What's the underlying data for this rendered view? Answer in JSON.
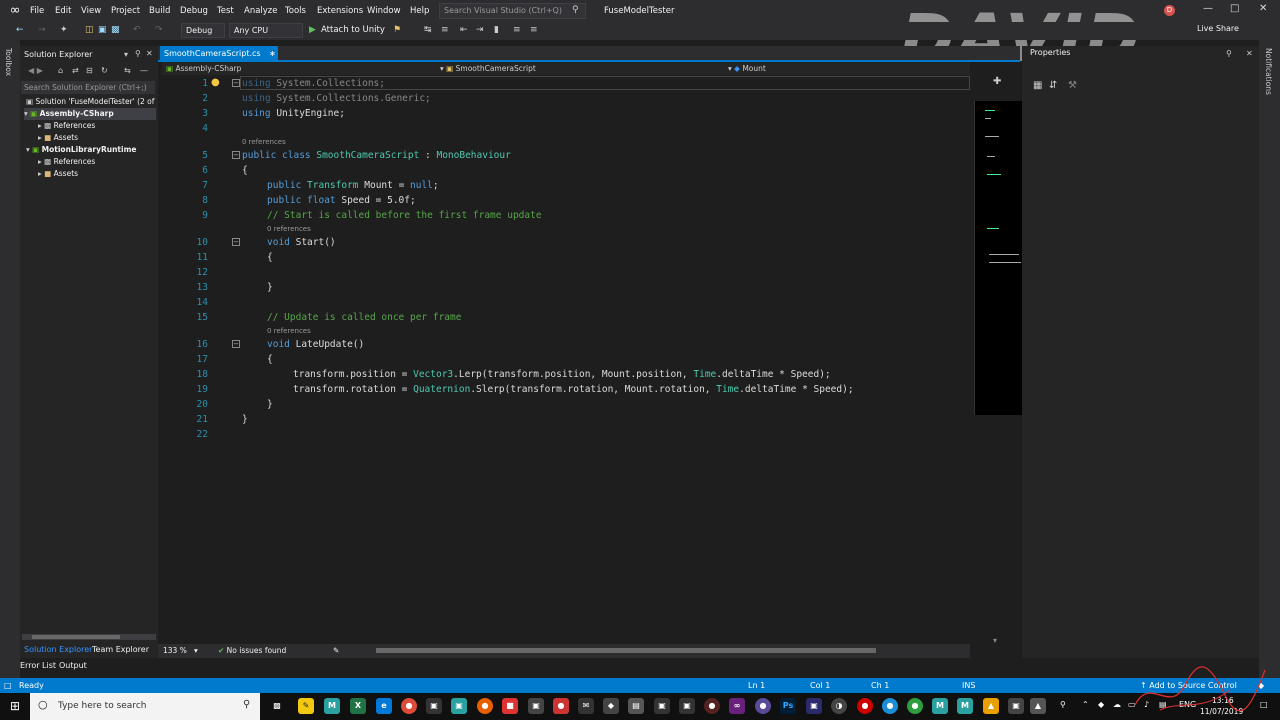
{
  "menu": [
    "File",
    "Edit",
    "View",
    "Project",
    "Build",
    "Debug",
    "Test",
    "Analyze",
    "Tools",
    "Extensions",
    "Window",
    "Help"
  ],
  "search_placeholder": "Search Visual Studio (Ctrl+Q)",
  "solution_name": "FuseModelTester",
  "watermark": "DAVID BLISSETT",
  "user_initial": "D",
  "toolbar": {
    "config": "Debug",
    "platform": "Any CPU",
    "attach": "Attach to Unity",
    "live_share": "Live Share"
  },
  "side_labels": {
    "toolbox": "Toolbox",
    "notifications": "Notifications"
  },
  "solution_explorer": {
    "title": "Solution Explorer",
    "search_placeholder": "Search Solution Explorer (Ctrl+;)",
    "tree": [
      {
        "label": "Solution 'FuseModelTester' (2 of",
        "bold": false
      },
      {
        "label": "Assembly-CSharp",
        "bold": true
      },
      {
        "label": "References",
        "bold": false
      },
      {
        "label": "Assets",
        "bold": false
      },
      {
        "label": "MotionLibraryRuntime",
        "bold": true
      },
      {
        "label": "References",
        "bold": false
      },
      {
        "label": "Assets",
        "bold": false
      }
    ],
    "bottom_tabs": [
      "Solution Explorer",
      "Team Explorer"
    ]
  },
  "output_tabs": [
    "Error List",
    "Output"
  ],
  "editor": {
    "tab": "SmoothCameraScript.cs",
    "nav": [
      "Assembly-CSharp",
      "SmoothCameraScript",
      "Mount"
    ],
    "codelens": "0 references",
    "lines": {
      "l1a": "using",
      "l1b": " System.Collections;",
      "l2a": "using",
      "l2b": " System.Collections.Generic;",
      "l3a": "using",
      "l3b": " UnityEngine;",
      "l5a": "public class ",
      "l5b": "SmoothCameraScript",
      "l5c": " : ",
      "l5d": "MonoBehaviour",
      "l6": "{",
      "l7a": "public ",
      "l7b": "Transform",
      "l7c": " Mount = ",
      "l7d": "null",
      "l7e": ";",
      "l8a": "public float",
      "l8b": " Speed = 5.0f;",
      "l9": "// Start is called before the first frame update",
      "l10a": "void",
      "l10b": " Start()",
      "l11": "{",
      "l13": "}",
      "l15": "// Update is called once per frame",
      "l16a": "void",
      "l16b": " LateUpdate()",
      "l17": "{",
      "l18a": "transform.position = ",
      "l18b": "Vector3",
      "l18c": ".Lerp(transform.position, Mount.position, ",
      "l18d": "Time",
      "l18e": ".deltaTime * Speed);",
      "l19a": "transform.rotation = ",
      "l19b": "Quaternion",
      "l19c": ".Slerp(transform.rotation, Mount.rotation, ",
      "l19d": "Time",
      "l19e": ".deltaTime * Speed);",
      "l20": "}",
      "l21": "}"
    },
    "line_numbers": [
      "1",
      "2",
      "3",
      "4",
      "5",
      "6",
      "7",
      "8",
      "9",
      "10",
      "11",
      "12",
      "13",
      "14",
      "15",
      "16",
      "17",
      "18",
      "19",
      "20",
      "21",
      "22"
    ],
    "zoom": "133 %",
    "issues": "No issues found"
  },
  "properties": {
    "title": "Properties"
  },
  "status": {
    "ready": "Ready",
    "ln": "Ln 1",
    "col": "Col 1",
    "ch": "Ch 1",
    "ins": "INS",
    "source_control": "Add to Source Control"
  },
  "taskbar": {
    "search_placeholder": "Type here to search",
    "language": "ENG",
    "time": "13:16",
    "date": "11/07/2019"
  },
  "colors": {
    "accent": "#007acc",
    "keyword": "#569cd6",
    "type": "#4ec9b0",
    "comment": "#57a64a",
    "line_number": "#2b91af"
  }
}
